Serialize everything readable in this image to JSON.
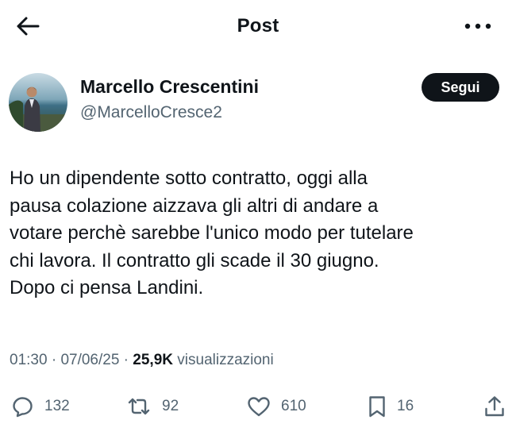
{
  "header": {
    "back_icon": "arrow-left-icon",
    "title": "Post",
    "more_icon": "more-horizontal-icon"
  },
  "author": {
    "display_name": "Marcello Crescentini",
    "handle": "@MarcelloCresce2",
    "follow_label": "Segui"
  },
  "post": {
    "lines": [
      "Ho un dipendente sotto contratto, oggi alla",
      "pausa colazione aizzava gli altri di andare a",
      "votare perchè sarebbe l'unico modo per tutelare",
      "chi lavora. Il contratto gli scade il 30 giugno.",
      "Dopo ci pensa Landini."
    ],
    "time": "01:30",
    "sep1": " · ",
    "date": "07/06/25",
    "sep2": " · ",
    "views": "25,9K",
    "views_label": " visualizzazioni"
  },
  "actions": {
    "replies": "132",
    "reposts": "92",
    "likes": "610",
    "bookmarks": "16"
  },
  "colors": {
    "text": "#0f1419",
    "secondary": "#536471",
    "button": "#0f1419"
  }
}
